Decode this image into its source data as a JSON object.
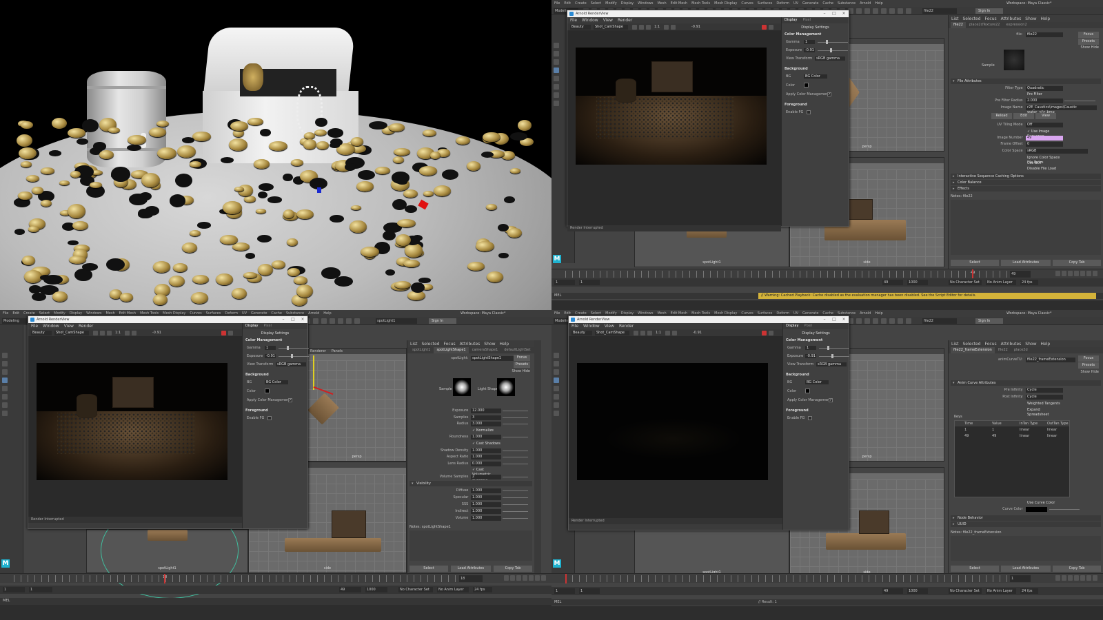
{
  "maya": {
    "menu": [
      "File",
      "Edit",
      "Create",
      "Select",
      "Modify",
      "Display",
      "Windows",
      "Mesh",
      "Edit Mesh",
      "Mesh Tools",
      "Mesh Display",
      "Curves",
      "Surfaces",
      "Deform",
      "UV",
      "Generate",
      "Cache",
      "Substance",
      "Arnold",
      "Help"
    ],
    "mode": "Modeling",
    "workspace_label": "Workspace:",
    "workspace_value": "Maya Classic*",
    "sign_in": "Sign In",
    "render_view_title": "Arnold RenderView",
    "render_view_menu": [
      "File",
      "Window",
      "View",
      "Render"
    ],
    "aov": "Beauty",
    "camera": "Shot_CamShape",
    "ratio": "1:1",
    "exposure_toolbar": "-0.91",
    "side_tabs": [
      "Display",
      "Pixel"
    ],
    "display_settings": "Display Settings",
    "color_management": "Color Management",
    "gamma_label": "Gamma",
    "gamma_value": "1",
    "exposure_label": "Exposure",
    "exposure_value": "-0.91",
    "view_transform_label": "View Transform",
    "view_transform_value": "sRGB gamma",
    "background": "Background",
    "bg_label": "BG",
    "bg_value": "BG Color",
    "color_label": "Color",
    "apply_cm": "Apply Color Management",
    "foreground": "Foreground",
    "enable_fg": "Enable FG",
    "status": "Render Interrupted",
    "viewport_menu": [
      "Renderer",
      "Panels"
    ],
    "persp": "persp",
    "side": "side",
    "spotlight_view": "spotLight1",
    "check": "✓",
    "mel": "MEL",
    "warning": "// Warning: Cached Playback: Cache disabled as the evaluation manager has been disabled. See the Script Editor for details.",
    "result": "// Result: 1",
    "no_char_set": "No Character Set",
    "no_anim_layer": "No Anim Layer",
    "fps": "24 fps"
  },
  "q2": {
    "search": "file22",
    "attr_menu": [
      "List",
      "Selected",
      "Focus",
      "Attributes",
      "Show",
      "Help"
    ],
    "tabs": [
      "file22",
      "place2dTexture22",
      "expression2"
    ],
    "file_label": "file:",
    "file_value": "file22",
    "focus": "Focus",
    "presets": "Presets",
    "show": "Show",
    "hide": "Hide",
    "sample": "Sample",
    "file_attributes": "File Attributes",
    "filter_type_label": "Filter Type",
    "filter_type": "Quadratic",
    "pre_filter": "Pre Filter",
    "pre_filter_radius_label": "Pre Filter Radius",
    "pre_filter_radius": "2.000",
    "image_name_label": "Image Name",
    "image_name": "r2E_Caustics\\images\\Caustic water_<f>.bmp",
    "reload": "Reload",
    "edit": "Edit",
    "view": "View",
    "uv_tiling_label": "UV Tiling Mode",
    "uv_tiling": "Off",
    "use_image_sequence": "Use Image Sequence",
    "image_number_label": "Image Number",
    "image_number": "49",
    "frame_offset_label": "Frame Offset",
    "frame_offset": "0",
    "color_space_label": "Color Space",
    "color_space": "sRGB",
    "ignore_cs": "Ignore Color Space File Rules",
    "use_bot": "Use BOT",
    "disable_file_load": "Disable File Load",
    "sections": [
      "Interactive Sequence Caching Options",
      "Color Balance",
      "Effects"
    ],
    "notes": "Notes: file22",
    "select": "Select",
    "load_attributes": "Load Attributes",
    "copy_tab": "Copy Tab",
    "current_frame": "49",
    "range_start": "1",
    "range_start2": "1",
    "range_end": "49",
    "range_end2": "1000",
    "tick_label": "49"
  },
  "q3": {
    "search": "spotLight1",
    "tabs": [
      "spotLight1",
      "spotLightShape1",
      "cameraShape1",
      "defaultLightSet"
    ],
    "spotlight_label": "spotLight:",
    "spotlight_value": "spotLightShape1",
    "sample": "Sample",
    "light_shape": "Light Shape",
    "rows": [
      {
        "label": "Exposure",
        "value": "12.000"
      },
      {
        "label": "Samples",
        "value": "3"
      },
      {
        "label": "Radius",
        "value": "3.000"
      },
      {
        "label": "",
        "value": "Normalize"
      },
      {
        "label": "Roundness",
        "value": "1.000"
      },
      {
        "label": "",
        "value": "Cast Shadows"
      },
      {
        "label": "Shadow Density",
        "value": "1.000"
      },
      {
        "label": "Aspect Ratio",
        "value": "1.000"
      },
      {
        "label": "Lens Radius",
        "value": "0.000"
      },
      {
        "label": "",
        "value": "Cast Volumetric Shadows"
      },
      {
        "label": "Volume Samples",
        "value": "2"
      }
    ],
    "visibility": "Visibility",
    "vis_rows": [
      {
        "label": "Diffuse",
        "value": "1.000"
      },
      {
        "label": "Specular",
        "value": "1.000"
      },
      {
        "label": "SSS",
        "value": "1.000"
      },
      {
        "label": "Indirect",
        "value": "1.000"
      },
      {
        "label": "Volume",
        "value": "1.000"
      }
    ],
    "notes": "Notes: spotLightShape1",
    "current_frame": "18",
    "range_start": "1",
    "range_start2": "1",
    "range_end": "49",
    "range_end2": "1000",
    "tick_label": "18"
  },
  "q4": {
    "search": "file22",
    "tabs": [
      "file22_frameExtension",
      "file22",
      "place2d"
    ],
    "curve_label": "animCurveTU:",
    "curve_value": "file22_frameExtension",
    "anim_curve_attrs": "Anim Curve Attributes",
    "pre_infinity_label": "Pre Infinity",
    "pre_infinity": "Cycle",
    "post_infinity_label": "Post Infinity",
    "post_infinity": "Cycle",
    "weighted": "Weighted Tangents",
    "expand": "Expand Spreadsheet",
    "keys": "Keys",
    "cols": [
      "Time",
      "Value",
      "InTan Type",
      "OutTan Type"
    ],
    "keyrows": [
      [
        "1",
        "1",
        "linear",
        "linear"
      ],
      [
        "49",
        "49",
        "linear",
        "linear"
      ]
    ],
    "use_curve_color": "Use Curve Color",
    "curve_color": "Curve Color",
    "sections": [
      "Node Behavior",
      "UUID"
    ],
    "notes": "Notes: file22_frameExtension",
    "current_frame": "1",
    "range_start": "1",
    "range_start2": "1",
    "range_end": "49",
    "range_end2": "1000"
  },
  "colors": {
    "accent": "#5a7fa8",
    "warning": "#d4b33a",
    "image_number_bg": "#d9a6f0"
  }
}
